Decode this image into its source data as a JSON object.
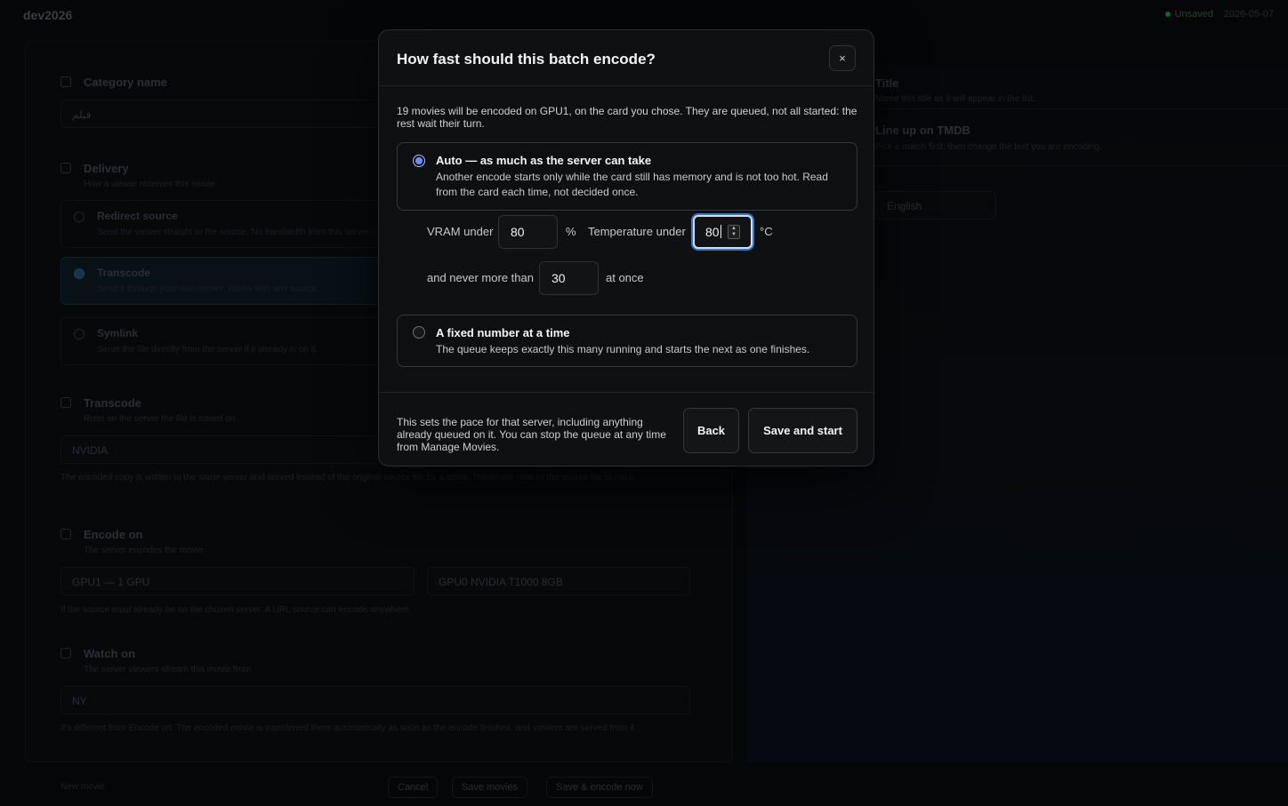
{
  "background": {
    "app_name": "dev2026",
    "status_text": "Unsaved",
    "clock_text": "2026-05-07",
    "sections": {
      "category_name": "Category name",
      "category_value": "فيلم",
      "delivery": "Delivery",
      "delivery_sub": "How a viewer receives this movie",
      "redirect_source": "Redirect source",
      "redirect_source_desc": "Send the viewer straight to the source. No bandwidth from this server.",
      "transcode_option": "Transcode",
      "transcode_option_desc": "Send it through your own server. Works with any source.",
      "symlink": "Symlink",
      "symlink_desc": "Serve the file directly from the server if it already is on it.",
      "transcode": "Transcode",
      "transcode_sub": "Runs on the server the file is saved on",
      "transcode_value": "NVIDIA",
      "transcode_note": "The encoded copy is written to the same server and served instead of the original source file for a quick. Transcode near to the source file to run it.",
      "encode_on": "Encode on",
      "encode_on_sub": "The server encodes the movie",
      "encode_server": "GPU1 — 1 GPU",
      "encode_card": "GPU0 NVIDIA T1000 8GB",
      "encode_note": "If the source must already be on the chosen server. A URL source can encode anywhere.",
      "watch_on": "Watch on",
      "watch_on_sub": "The server viewers stream this movie from",
      "watch_value": "NY",
      "watch_note": "It's different from Encode on. The encoded movie is transferred there automatically as soon as the encode finishes, and viewers are served from it.",
      "right_title": "Title",
      "right_sub": "Name this title as it will appear in the list.",
      "right_line": "Line up on TMDB",
      "right_line_sub": "Pick a match first, then change the text you are encoding.",
      "right_lang": "English"
    },
    "footer": {
      "new_movie": "New movie",
      "cancel": "Cancel",
      "save_movies": "Save movies",
      "save_encode": "Save & encode now"
    }
  },
  "modal": {
    "title": "How fast should this batch encode?",
    "close_label": "×",
    "intro": "19 movies will be encoded on GPU1, on the card you chose. They are queued, not all started: the rest wait their turn.",
    "option_auto": {
      "title": "Auto — as much as the server can take",
      "description": "Another encode starts only while the card still has memory and is not too hot. Read from the card each time, not decided once.",
      "selected": true
    },
    "limits": {
      "vram_label": "VRAM under",
      "vram_value": "80",
      "vram_unit": "%",
      "temp_label": "Temperature under",
      "temp_value": "80",
      "temp_unit": "°C",
      "max_prefix": "and never more than",
      "max_value": "30",
      "max_suffix": "at once"
    },
    "option_fixed": {
      "title": "A fixed number at a time",
      "description": "The queue keeps exactly this many running and starts the next as one finishes.",
      "selected": false
    },
    "footer_note": "This sets the pace for that server, including anything already queued on it. You can stop the queue at any time from Manage Movies.",
    "back_label": "Back",
    "save_label": "Save and start"
  }
}
